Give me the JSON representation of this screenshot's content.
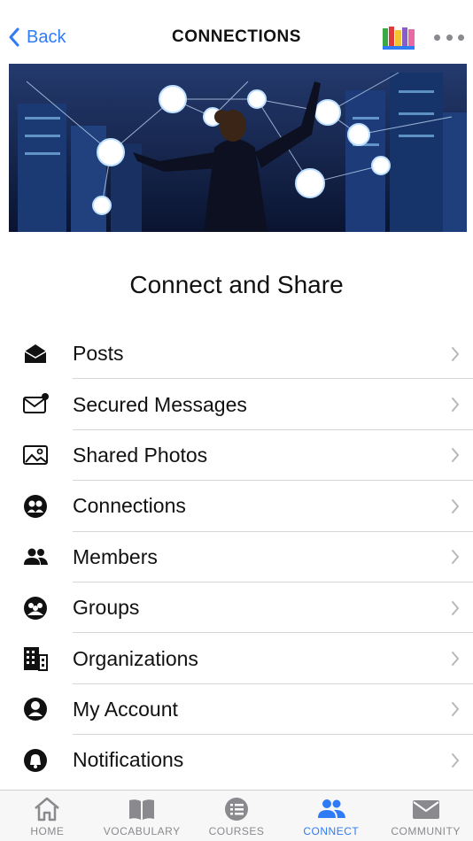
{
  "header": {
    "back_label": "Back",
    "title": "CONNECTIONS",
    "logo_icon": "app-logo",
    "more_icon": "more-dots-icon"
  },
  "hero": {
    "icon": "network-hero-image"
  },
  "heading": "Connect and Share",
  "menu": [
    {
      "label": "Posts",
      "icon": "envelope-open-icon"
    },
    {
      "label": "Secured Messages",
      "icon": "mail-notification-icon"
    },
    {
      "label": "Shared Photos",
      "icon": "photo-icon"
    },
    {
      "label": "Connections",
      "icon": "connections-icon"
    },
    {
      "label": "Members",
      "icon": "members-icon"
    },
    {
      "label": "Groups",
      "icon": "groups-icon"
    },
    {
      "label": "Organizations",
      "icon": "building-icon"
    },
    {
      "label": "My Account",
      "icon": "account-icon"
    },
    {
      "label": "Notifications",
      "icon": "bell-icon"
    }
  ],
  "tabbar": {
    "tabs": [
      {
        "label": "HOME",
        "icon": "home-icon",
        "active": false
      },
      {
        "label": "VOCABULARY",
        "icon": "book-icon",
        "active": false
      },
      {
        "label": "COURSES",
        "icon": "list-icon",
        "active": false
      },
      {
        "label": "CONNECT",
        "icon": "people-icon",
        "active": true
      },
      {
        "label": "COMMUNITY",
        "icon": "envelope-icon",
        "active": false
      }
    ]
  },
  "colors": {
    "accent": "#2f7bf5",
    "inactive": "#8a8a8e",
    "separator": "#d6d6d8"
  }
}
